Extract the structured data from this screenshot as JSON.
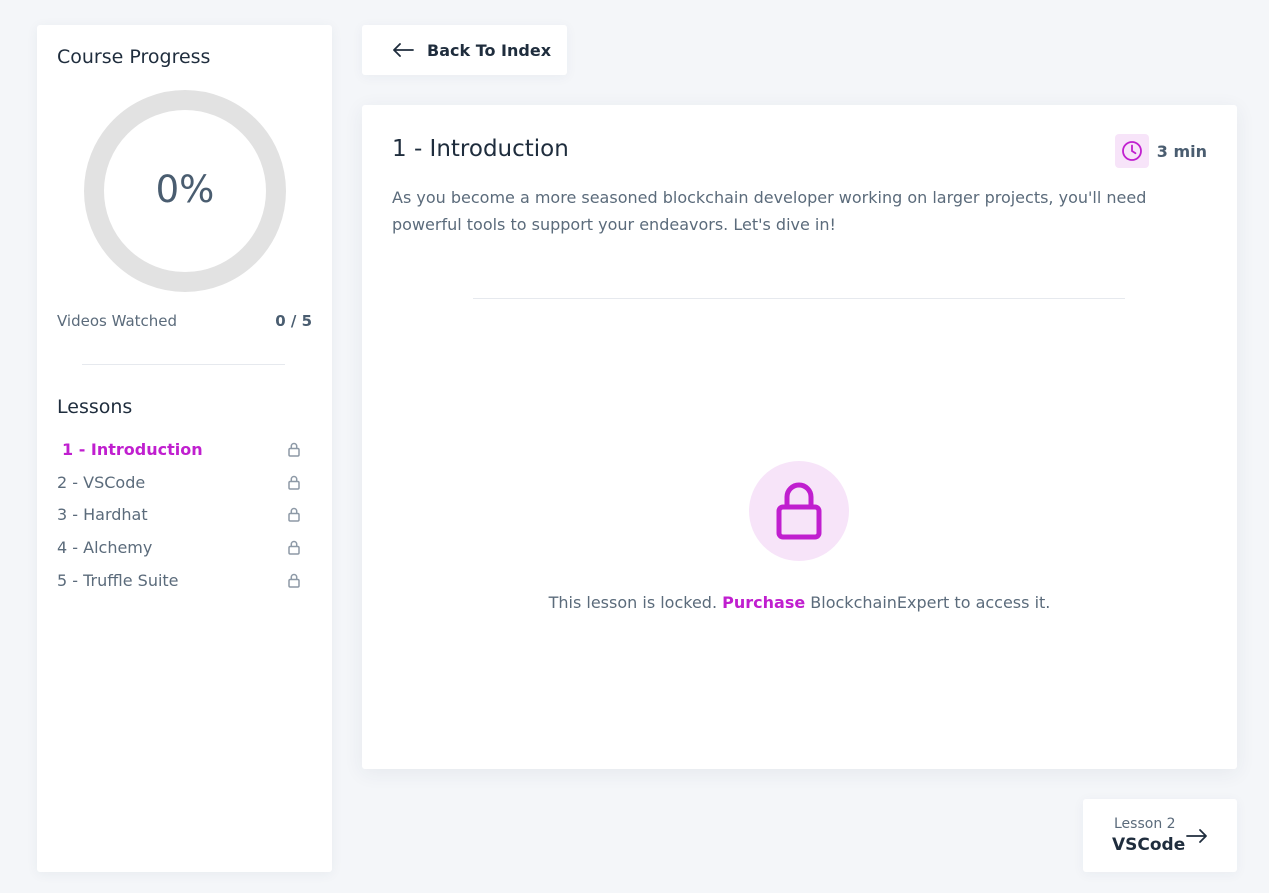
{
  "sidebar": {
    "title": "Course Progress",
    "progress_label": "0%",
    "progress_fraction": 0,
    "videos_label": "Videos Watched",
    "videos_count": "0 / 5",
    "lessons_title": "Lessons",
    "lessons": [
      {
        "label": "1 - Introduction",
        "active": true,
        "locked": true
      },
      {
        "label": "2 - VSCode",
        "active": false,
        "locked": true
      },
      {
        "label": "3 - Hardhat",
        "active": false,
        "locked": true
      },
      {
        "label": "4 - Alchemy",
        "active": false,
        "locked": true
      },
      {
        "label": "5 - Truffle Suite",
        "active": false,
        "locked": true
      }
    ]
  },
  "header": {
    "back_label": "Back To Index",
    "back_icon": "arrow-left-icon"
  },
  "lesson": {
    "title": "1 - Introduction",
    "duration": "3 min",
    "duration_icon": "clock-icon",
    "description": "As you become a more seasoned blockchain developer working on larger projects, you'll need powerful tools to support your endeavors. Let's dive in!",
    "lock_icon": "lock-icon",
    "locked_prefix": "This lesson is locked.",
    "purchase_label": "Purchase",
    "locked_suffix": "BlockchainExpert to access it."
  },
  "next": {
    "caption": "Lesson 2",
    "title": "VSCode",
    "icon": "arrow-right-icon"
  },
  "colors": {
    "accent": "#c01fcf",
    "accent_soft": "#f7e4f9",
    "ring_track": "#e2e2e2",
    "background": "#f4f6f9"
  }
}
